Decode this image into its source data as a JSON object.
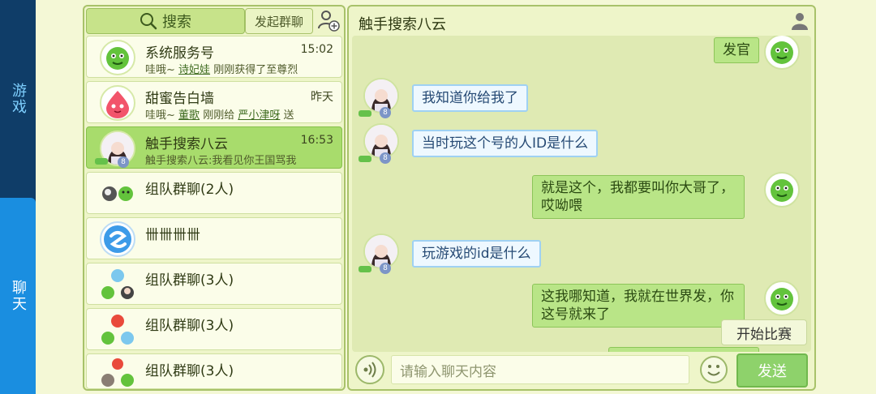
{
  "sidebar": {
    "tabs": [
      {
        "label": "游戏"
      },
      {
        "label": "聊天"
      }
    ]
  },
  "list_panel": {
    "search_label": "搜索",
    "group_chat_button": "发起群聊",
    "conversations": [
      {
        "name": "系统服务号",
        "time": "15:02",
        "preview_prefix": "哇哦~",
        "preview_link": "诗妃娃",
        "preview_suffix": "刚刚获得了至尊烈"
      },
      {
        "name": "甜蜜告白墙",
        "time": "昨天",
        "preview_prefix": "哇哦~",
        "preview_link": "董歌",
        "preview_middle": "刚刚给",
        "preview_link2": "严小津呀",
        "preview_suffix": "送"
      },
      {
        "name": "触手搜索八云",
        "time": "16:53",
        "preview": "触手搜索八云:我看见你王国骂我"
      },
      {
        "name": "组队群聊(2人)"
      },
      {
        "name": "卌卌卌卌"
      },
      {
        "name": "组队群聊(3人)"
      },
      {
        "name": "组队群聊(3人)"
      },
      {
        "name": "组队群聊(3人)"
      }
    ]
  },
  "chat_panel": {
    "title": "触手搜索八云",
    "messages": [
      {
        "side": "right",
        "text": "发官"
      },
      {
        "side": "left",
        "text": "我知道你给我了"
      },
      {
        "side": "left",
        "text": "当时玩这个号的人ID是什么"
      },
      {
        "side": "right",
        "text": "就是这个，我都要叫你大哥了，哎呦喂"
      },
      {
        "side": "left",
        "text": "玩游戏的id是什么"
      },
      {
        "side": "right",
        "text": "这我哪知道，我就在世界发，你这号就来了"
      }
    ],
    "input_placeholder": "请输入聊天内容",
    "send_label": "发送",
    "start_match_label": "开始比赛",
    "level_badge": "8"
  },
  "colors": {
    "sidebar_bg": "#0f3d68",
    "sidebar_active": "#1a8ee0",
    "page_bg": "#f4f8d6",
    "selected_row": "#a8dc6c",
    "right_bubble": "#b9e587",
    "left_bubble": "#eef8ff",
    "send_button": "#8ed26b"
  }
}
